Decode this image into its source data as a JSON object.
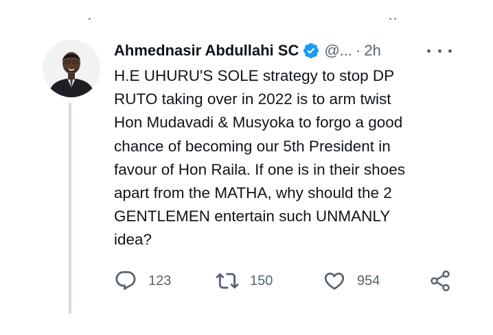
{
  "tweet": {
    "author_name": "Ahmednasir Abdullahi SC",
    "verified": true,
    "handle": "@...",
    "separator": "·",
    "time": "2h",
    "text_lines": [
      "H.E UHURU'S SOLE strategy to stop DP",
      "RUTO taking over in 2022 is to arm twist",
      "Hon Mudavadi & Musyoka to forgo a good",
      "chance of becoming our 5th President in",
      "favour of Hon Raila. If one is in their shoes",
      "apart from the MATHA, why should the 2",
      "GENTLEMEN entertain such UNMANLY",
      "idea?"
    ]
  },
  "actions": {
    "reply": {
      "icon": "reply-icon",
      "count": "123"
    },
    "retweet": {
      "icon": "retweet-icon",
      "count": "150"
    },
    "like": {
      "icon": "heart-icon",
      "count": "954"
    },
    "share": {
      "icon": "share-icon"
    }
  },
  "colors": {
    "text": "#0f1419",
    "secondary": "#536471",
    "verified_blue": "#1d9bf0",
    "thread_line": "#cfd9de"
  }
}
